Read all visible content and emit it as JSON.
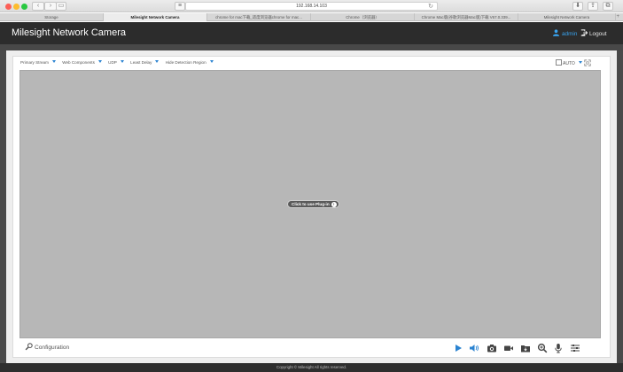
{
  "browser": {
    "address": "192.168.14.103",
    "tabs": [
      {
        "label": "Storage",
        "active": false
      },
      {
        "label": "Milesight Network Camera",
        "active": true
      },
      {
        "label": "chrome for mac下载_适度浏览器chrome for mac...",
        "active": false
      },
      {
        "label": "Chrome（浏览器）",
        "active": false
      },
      {
        "label": "Chrome Mac版(谷歌浏览器Mac版)下载 V67.0.339...",
        "active": false
      },
      {
        "label": "Milesight Network Camera",
        "active": false
      }
    ]
  },
  "header": {
    "brand": "Milesight Network Camera",
    "user": "admin",
    "logout": "Logout"
  },
  "controls": {
    "primary_stream": "Primary Stream",
    "web_components": "Web Components",
    "udp": "UDP",
    "least_delay": "Least Delay",
    "hide_detection_region": "Hide Detection Region",
    "auto": "AUTO"
  },
  "video": {
    "plugin_button": "Click to use Plug-in"
  },
  "bottom": {
    "configuration": "Configuration"
  },
  "footer": {
    "copyright": "Copyright © Milesight All rights reserved."
  },
  "colors": {
    "accent": "#2a83d1",
    "user": "#39a3ee",
    "header_bg": "#2c2c2c",
    "video_bg": "#b7b7b7"
  },
  "icons": {
    "tools": [
      "play-icon",
      "volume-icon",
      "snapshot-icon",
      "record-icon",
      "save-folder-icon",
      "zoom-icon",
      "microphone-icon",
      "adjust-icon"
    ]
  }
}
